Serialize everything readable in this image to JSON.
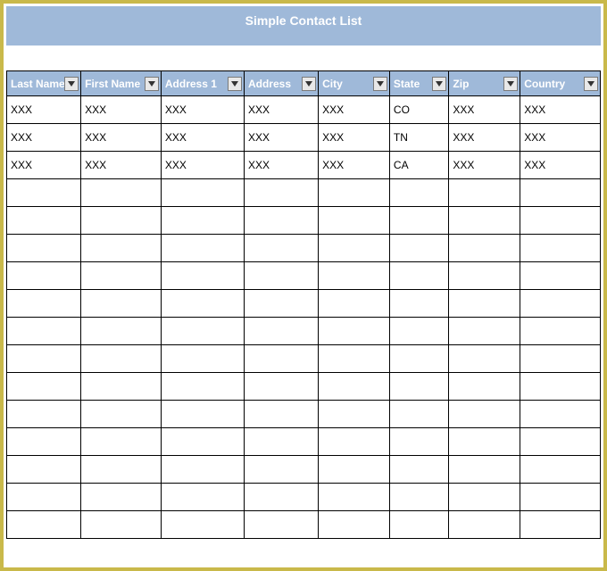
{
  "title": "Simple Contact List",
  "columns": [
    {
      "key": "last_name",
      "label": "Last Name"
    },
    {
      "key": "first_name",
      "label": "First Name"
    },
    {
      "key": "address1",
      "label": "Address 1"
    },
    {
      "key": "address2",
      "label": "Address"
    },
    {
      "key": "city",
      "label": "City"
    },
    {
      "key": "state",
      "label": "State"
    },
    {
      "key": "zip",
      "label": "Zip"
    },
    {
      "key": "country",
      "label": "Country"
    }
  ],
  "rows": [
    {
      "last_name": "XXX",
      "first_name": "XXX",
      "address1": "XXX",
      "address2": "XXX",
      "city": "XXX",
      "state": "CO",
      "zip": "XXX",
      "country": "XXX"
    },
    {
      "last_name": "XXX",
      "first_name": "XXX",
      "address1": "XXX",
      "address2": "XXX",
      "city": "XXX",
      "state": "TN",
      "zip": "XXX",
      "country": "XXX"
    },
    {
      "last_name": "XXX",
      "first_name": "XXX",
      "address1": "XXX",
      "address2": "XXX",
      "city": "XXX",
      "state": "CA",
      "zip": "XXX",
      "country": "XXX"
    }
  ],
  "empty_row_count": 13,
  "colors": {
    "frame_border": "#c9b94a",
    "header_bg": "#9fb9d9",
    "header_text": "#ffffff",
    "grid_line": "#000000"
  }
}
